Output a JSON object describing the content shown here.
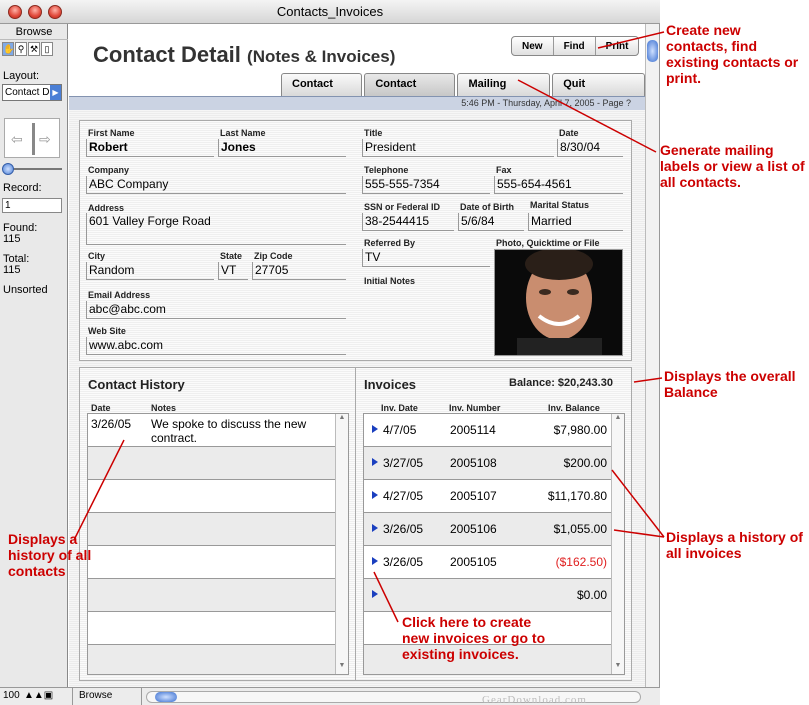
{
  "window": {
    "title": "Contacts_Invoices"
  },
  "status_area": {
    "mode": "Browse",
    "layout_label": "Layout:",
    "layout_value": "Contact D",
    "record_label": "Record:",
    "record_value": "1",
    "found_label": "Found:",
    "found_value": "115",
    "total_label": "Total:",
    "total_value": "115",
    "sort_state": "Unsorted"
  },
  "header": {
    "title": "Contact Detail",
    "subtitle": "(Notes & Invoices)",
    "buttons": {
      "new": "New",
      "find": "Find",
      "print": "Print"
    },
    "tabs": [
      "Contact List",
      "Contact Detail",
      "Mailing Labels",
      "Quit FileMaker"
    ],
    "active_tab": "Contact Detail",
    "date_line": "5:46 PM - Thursday, April 7, 2005 - Page ?"
  },
  "contact": {
    "first_name_label": "First Name",
    "first_name": "Robert",
    "last_name_label": "Last Name",
    "last_name": "Jones",
    "title_label": "Title",
    "title": "President",
    "date_label": "Date",
    "date": "8/30/04",
    "company_label": "Company",
    "company": "ABC Company",
    "telephone_label": "Telephone",
    "telephone": "555-555-7354",
    "fax_label": "Fax",
    "fax": "555-654-4561",
    "address_label": "Address",
    "address": "601 Valley Forge Road",
    "ssn_label": "SSN or Federal ID",
    "ssn": "38-2544415",
    "dob_label": "Date of Birth",
    "dob": "5/6/84",
    "marital_label": "Marital Status",
    "marital": "Married",
    "referred_label": "Referred By",
    "referred": "TV",
    "photo_label": "Photo, Quicktime or File",
    "initial_notes_label": "Initial Notes",
    "city_label": "City",
    "city": "Random",
    "state_label": "State",
    "state": "VT",
    "zip_label": "Zip Code",
    "zip": "27705",
    "email_label": "Email Address",
    "email": "abc@abc.com",
    "website_label": "Web Site",
    "website": "www.abc.com"
  },
  "history": {
    "title": "Contact History",
    "col_date": "Date",
    "col_notes": "Notes",
    "rows": [
      {
        "date": "3/26/05",
        "notes_line1": "We spoke to discuss the new",
        "notes_line2": "contract."
      }
    ]
  },
  "invoices": {
    "title": "Invoices",
    "balance": "Balance: $20,243.30",
    "col_date": "Inv. Date",
    "col_number": "Inv. Number",
    "col_balance": "Inv. Balance",
    "rows": [
      {
        "date": "4/7/05",
        "number": "2005114",
        "balance": "$7,980.00"
      },
      {
        "date": "3/27/05",
        "number": "2005108",
        "balance": "$200.00"
      },
      {
        "date": "4/27/05",
        "number": "2005107",
        "balance": "$11,170.80"
      },
      {
        "date": "3/26/05",
        "number": "2005106",
        "balance": "$1,055.00"
      },
      {
        "date": "3/26/05",
        "number": "2005105",
        "balance": "($162.50)"
      },
      {
        "date": "",
        "number": "",
        "balance": "$0.00"
      }
    ]
  },
  "bottom_bar": {
    "zoom": "100",
    "mode": "Browse",
    "watermark": "GearDownload.com"
  },
  "callouts": {
    "create": "Create new contacts, find existing contacts or print.",
    "mailing": "Generate mailing labels or view a list of all contacts.",
    "balance": "Displays the overall Balance",
    "invoices": "Displays a history of all invoices",
    "history": "Displays a history of all contacts",
    "click": "Click here to create new invoices or go to existing invoices."
  },
  "colors": {
    "callout": "#cc0000",
    "accent": "#3a6fd0",
    "negative": "#e02020"
  }
}
